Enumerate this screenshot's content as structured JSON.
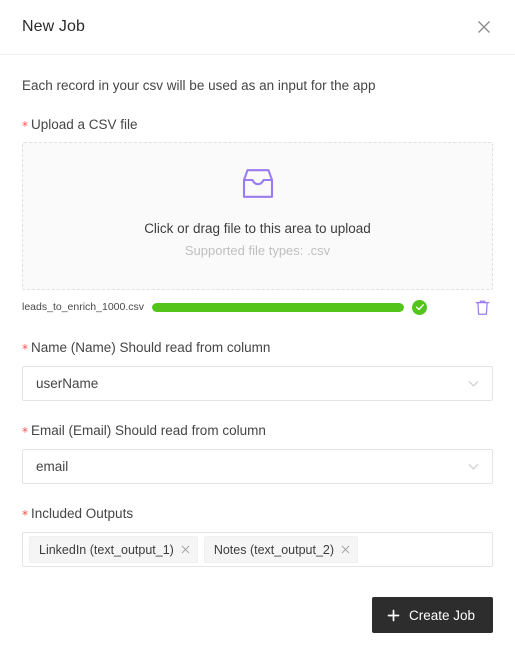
{
  "modal": {
    "title": "New Job",
    "close_icon": "close-icon",
    "intro": "Each record in your csv will be used as an input for the app"
  },
  "upload": {
    "label": "Upload a CSV file",
    "required_marker": "*",
    "icon": "inbox-icon",
    "primary_text": "Click or drag file to this area to upload",
    "secondary_text": "Supported file types: .csv",
    "file": {
      "name": "leads_to_enrich_1000.csv",
      "progress_percent": 100,
      "status_icon": "check-circle-icon",
      "delete_icon": "trash-icon",
      "progress_color": "#52c41a"
    }
  },
  "fields": [
    {
      "label": "Name (Name) Should read from column",
      "required_marker": "*",
      "value": "userName",
      "icon": "chevron-down-icon",
      "name": "name-column-select"
    },
    {
      "label": "Email (Email) Should read from column",
      "required_marker": "*",
      "value": "email",
      "icon": "chevron-down-icon",
      "name": "email-column-select"
    }
  ],
  "outputs": {
    "label": "Included Outputs",
    "required_marker": "*",
    "tags": [
      {
        "label": "LinkedIn (text_output_1)",
        "close_icon": "close-icon"
      },
      {
        "label": "Notes (text_output_2)",
        "close_icon": "close-icon"
      }
    ]
  },
  "footer": {
    "create_label": "Create Job",
    "create_icon": "plus-icon",
    "create_bg": "#2d2d2d"
  },
  "theme": {
    "accent": "#9b7cf0",
    "success": "#52c41a",
    "required": "#ff4d4f"
  }
}
